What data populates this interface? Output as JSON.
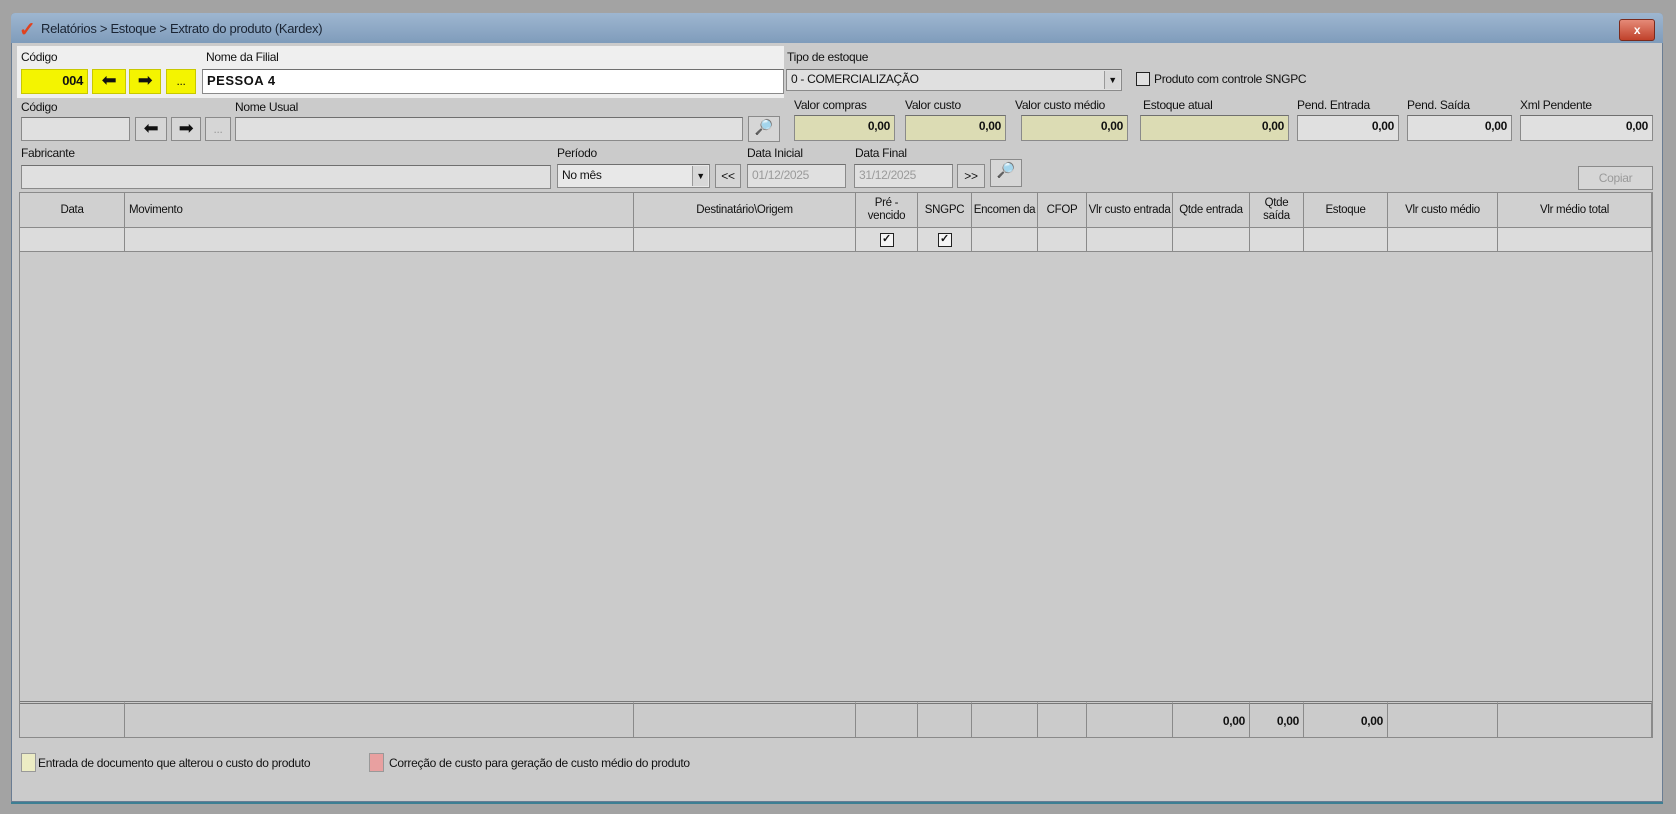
{
  "window": {
    "title": "Relatórios > Estoque > Extrato do produto (Kardex)",
    "close": "x"
  },
  "filial": {
    "codigo_label": "Código",
    "codigo": "004",
    "nome_label": "Nome da Filial",
    "nome": "PESSOA 4",
    "dots": "..."
  },
  "tipo_estoque": {
    "label": "Tipo de estoque",
    "value": "0 - COMERCIALIZAÇÃO",
    "sngpc_label": "Produto com controle SNGPC"
  },
  "produto": {
    "codigo_label": "Código",
    "codigo": "",
    "dots": "...",
    "nome_usual_label": "Nome Usual",
    "nome_usual": "",
    "fabricante_label": "Fabricante",
    "fabricante": ""
  },
  "valores": [
    {
      "label": "Valor compras",
      "value": "0,00"
    },
    {
      "label": "Valor custo",
      "value": "0,00"
    },
    {
      "label": "Valor custo médio",
      "value": "0,00"
    },
    {
      "label": "Estoque atual",
      "value": "0,00"
    },
    {
      "label": "Pend. Entrada",
      "value": "0,00"
    },
    {
      "label": "Pend. Saída",
      "value": "0,00"
    },
    {
      "label": "Xml Pendente",
      "value": "0,00"
    }
  ],
  "periodo": {
    "label": "Período",
    "value": "No mês",
    "prev": "<<",
    "next": ">>",
    "data_inicial_label": "Data Inicial",
    "data_inicial": "01/12/2025",
    "data_final_label": "Data Final",
    "data_final": "31/12/2025"
  },
  "copiar": "Copiar",
  "grid": {
    "columns": [
      "Data",
      "Movimento",
      "Destinatário\\Origem",
      "Pré - vencido",
      "SNGPC",
      "Encomen da",
      "CFOP",
      "Vlr custo entrada",
      "Qtde entrada",
      "Qtde saída",
      "Estoque",
      "Vlr custo médio",
      "Vlr médio total"
    ],
    "footer": [
      "",
      "",
      "",
      "",
      "",
      "",
      "",
      "",
      "0,00",
      "0,00",
      "0,00",
      "",
      ""
    ]
  },
  "legend": [
    {
      "label": "Entrada de documento que alterou o custo do produto",
      "color": "#ececc4"
    },
    {
      "label": "Correção de custo para geração de custo médio do produto",
      "color": "#e8a0a0"
    }
  ]
}
